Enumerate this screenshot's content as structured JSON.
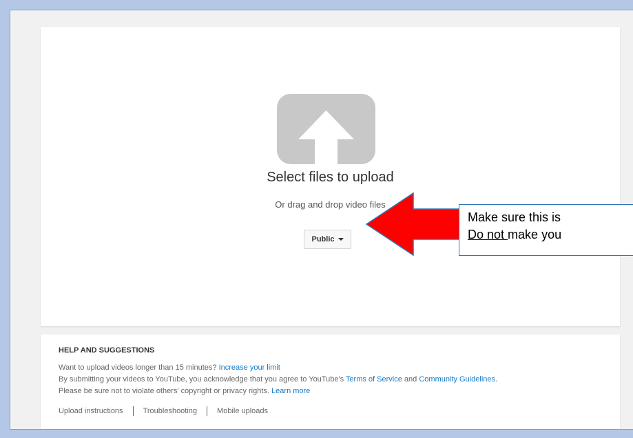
{
  "upload": {
    "title": "Select files to upload",
    "subtitle": "Or drag and drop video files",
    "privacy_value": "Public"
  },
  "help": {
    "heading": "HELP AND SUGGESTIONS",
    "line1_text": "Want to upload videos longer than 15 minutes?",
    "line1_link": "Increase your limit",
    "line2_text": "By submitting your videos to YouTube, you acknowledge that you agree to YouTube's",
    "line2_link1": "Terms of Service",
    "line2_and": "and",
    "line2_link2": "Community Guidelines",
    "line2_end": ".",
    "line3_text": "Please be sure not to violate others' copyright or privacy rights.",
    "line3_link": "Learn more",
    "links": [
      "Upload instructions",
      "Troubleshooting",
      "Mobile uploads"
    ]
  },
  "callout": {
    "line1": "Make sure this is",
    "line2_underlined": "Do not ",
    "line2_rest": "make you"
  },
  "colors": {
    "background": "#b4c7e7",
    "arrow_fill": "#ff0000",
    "arrow_outline": "#2e75b6",
    "link": "#167ac6"
  }
}
